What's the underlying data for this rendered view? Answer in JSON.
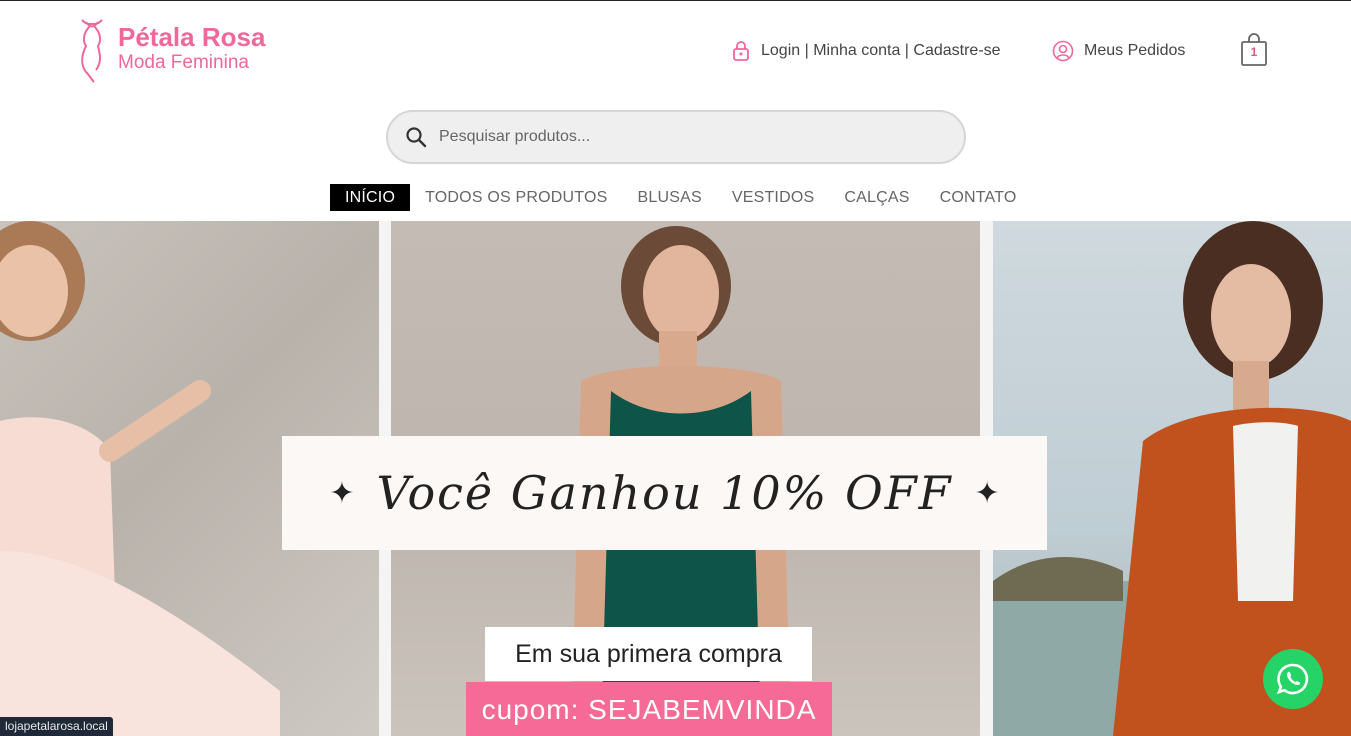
{
  "brand": {
    "title": "Pétala Rosa",
    "subtitle": "Moda Feminina",
    "color": "#f0679a"
  },
  "header": {
    "account_text": "Login | Minha conta | Cadastre-se",
    "account_icon": "lock-icon",
    "orders_label": "Meus Pedidos",
    "orders_icon": "user-circle-icon",
    "cart_count": "1",
    "cart_icon": "shopping-bag-icon"
  },
  "search": {
    "placeholder": "Pesquisar produtos...",
    "value": "",
    "icon": "search-icon"
  },
  "nav": {
    "items": [
      {
        "label": "INÍCIO",
        "active": true
      },
      {
        "label": "TODOS OS PRODUTOS",
        "active": false
      },
      {
        "label": "BLUSAS",
        "active": false
      },
      {
        "label": "VESTIDOS",
        "active": false
      },
      {
        "label": "CALÇAS",
        "active": false
      },
      {
        "label": "CONTATO",
        "active": false
      }
    ]
  },
  "hero": {
    "headline": "Você Ganhou 10% OFF",
    "first_purchase": "Em sua primera compra",
    "coupon": "cupom: SEJABEMVINDA",
    "accent_color": "#f56a96"
  },
  "floating": {
    "whatsapp_icon": "whatsapp-icon",
    "color": "#25d366"
  },
  "status_bar": {
    "url": "lojapetalarosa.local"
  }
}
